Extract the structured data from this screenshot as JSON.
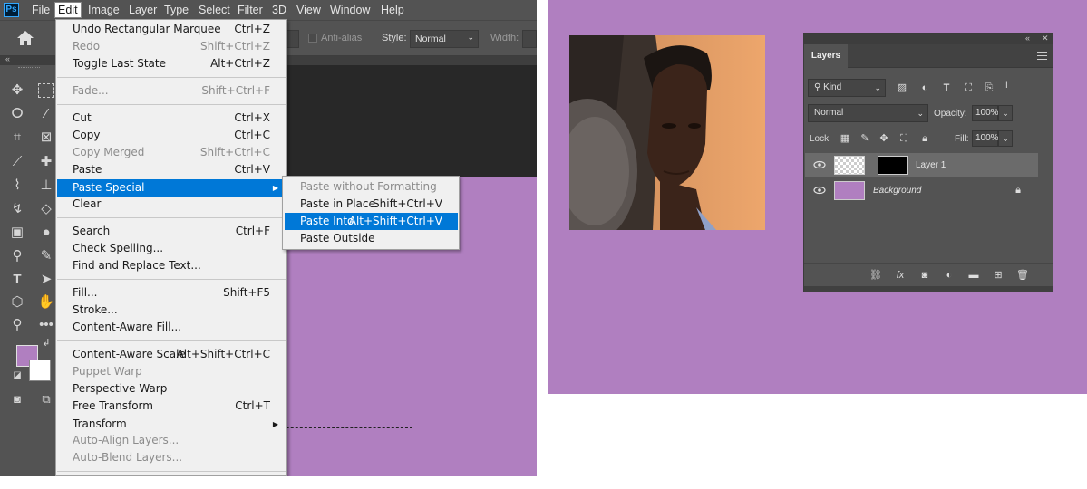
{
  "app": {
    "logo": "Ps",
    "menu": [
      "File",
      "Edit",
      "Image",
      "Layer",
      "Type",
      "Select",
      "Filter",
      "3D",
      "View",
      "Window",
      "Help"
    ],
    "active_menu": "Edit"
  },
  "options_bar": {
    "anti_alias_label": "Anti-alias",
    "style_label": "Style:",
    "style_value": "Normal",
    "width_label": "Width:"
  },
  "edit_menu": {
    "undo": {
      "label": "Undo Rectangular Marquee",
      "shortcut": "Ctrl+Z"
    },
    "redo": {
      "label": "Redo",
      "shortcut": "Shift+Ctrl+Z"
    },
    "toggle": {
      "label": "Toggle Last State",
      "shortcut": "Alt+Ctrl+Z"
    },
    "fade": {
      "label": "Fade...",
      "shortcut": "Shift+Ctrl+F"
    },
    "cut": {
      "label": "Cut",
      "shortcut": "Ctrl+X"
    },
    "copy": {
      "label": "Copy",
      "shortcut": "Ctrl+C"
    },
    "copy_merged": {
      "label": "Copy Merged",
      "shortcut": "Shift+Ctrl+C"
    },
    "paste": {
      "label": "Paste",
      "shortcut": "Ctrl+V"
    },
    "paste_special": {
      "label": "Paste Special"
    },
    "clear": {
      "label": "Clear"
    },
    "search": {
      "label": "Search",
      "shortcut": "Ctrl+F"
    },
    "check_spelling": {
      "label": "Check Spelling..."
    },
    "find_replace": {
      "label": "Find and Replace Text..."
    },
    "fill": {
      "label": "Fill...",
      "shortcut": "Shift+F5"
    },
    "stroke": {
      "label": "Stroke..."
    },
    "content_aware_fill": {
      "label": "Content-Aware Fill..."
    },
    "content_aware_scale": {
      "label": "Content-Aware Scale",
      "shortcut": "Alt+Shift+Ctrl+C"
    },
    "puppet_warp": {
      "label": "Puppet Warp"
    },
    "perspective_warp": {
      "label": "Perspective Warp"
    },
    "free_transform": {
      "label": "Free Transform",
      "shortcut": "Ctrl+T"
    },
    "transform": {
      "label": "Transform"
    },
    "auto_align": {
      "label": "Auto-Align Layers..."
    },
    "auto_blend": {
      "label": "Auto-Blend Layers..."
    }
  },
  "paste_special_menu": {
    "without_formatting": {
      "label": "Paste without Formatting"
    },
    "in_place": {
      "label": "Paste in Place",
      "shortcut": "Shift+Ctrl+V"
    },
    "into": {
      "label": "Paste Into",
      "shortcut": "Alt+Shift+Ctrl+V"
    },
    "outside": {
      "label": "Paste Outside"
    }
  },
  "layers_panel": {
    "tab": "Layers",
    "filter_kind": "Kind",
    "blend_mode": "Normal",
    "opacity_label": "Opacity:",
    "opacity_value": "100%",
    "lock_label": "Lock:",
    "fill_label": "Fill:",
    "fill_value": "100%",
    "layers": [
      {
        "name": "Layer 1"
      },
      {
        "name": "Background"
      }
    ]
  },
  "colors": {
    "canvas_purple": "#b07fc0",
    "menu_highlight": "#0078d7",
    "panel_bg": "#535353"
  }
}
